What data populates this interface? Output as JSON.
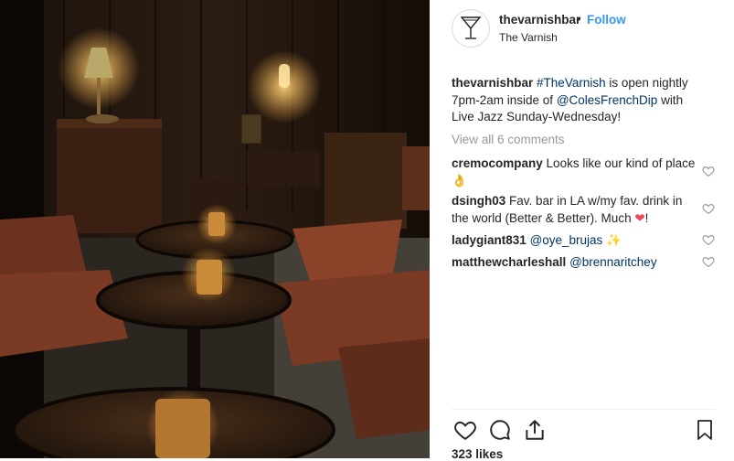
{
  "post": {
    "username": "thevarnishbar",
    "follow_label": "Follow",
    "separator": "•",
    "location": "The Varnish"
  },
  "caption": {
    "username": "thevarnishbar",
    "hashtag": "#TheVarnish",
    "text_1": " is open nightly 7pm-2am inside of ",
    "mention": "@ColesFrenchDip",
    "text_2": " with Live Jazz Sunday-Wednesday!"
  },
  "view_all_comments": "View all 6 comments",
  "comments": [
    {
      "user": "cremocompany",
      "text": " Looks like our kind of place ",
      "emoji": "👌"
    },
    {
      "user": "dsingh03",
      "text": " Fav. bar in LA w/my fav. drink in the world (Better & Better). Much ",
      "emoji": "❤",
      "suffix": "!"
    },
    {
      "user": "ladygiant831",
      "mention": "@oye_brujas",
      "emoji": "✨"
    },
    {
      "user": "matthewcharleshall",
      "mention": "@brennaritchey"
    }
  ],
  "likes": "323 likes",
  "icons": {
    "avatar": "martini-glass-logo",
    "like": "heart-icon",
    "comment": "speech-bubble-icon",
    "share": "share-icon",
    "save": "bookmark-icon",
    "comment_like": "small-heart-icon"
  },
  "colors": {
    "link_blue": "#3897f0",
    "mention_blue": "#003569",
    "muted_gray": "#999999",
    "text": "#262626",
    "heart_red": "#ed4956"
  }
}
